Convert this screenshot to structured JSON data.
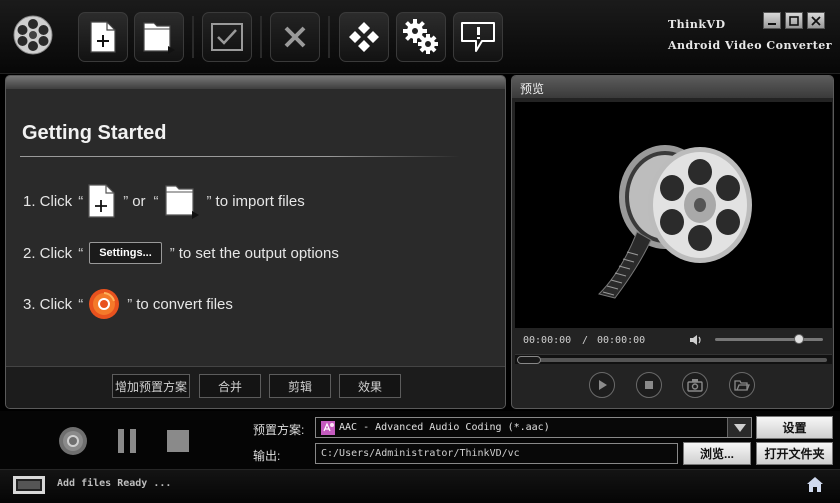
{
  "app": {
    "brand_line1": "ThinkVD",
    "brand_line2": "Android Video Converter"
  },
  "toolbar": {
    "icons": [
      "film-reel-icon",
      "add-file-icon",
      "add-folder-icon",
      "check-icon",
      "close-icon",
      "diamond-grid-icon",
      "gears-icon",
      "chat-bubble-icon"
    ]
  },
  "guide": {
    "title": "Getting Started",
    "step1": {
      "prefix": "1. Click",
      "or": "or",
      "suffix": "to import files"
    },
    "step2": {
      "prefix": "2. Click",
      "button": "Settings...",
      "suffix": "to set the output options"
    },
    "step3": {
      "prefix": "3. Click",
      "suffix": "to convert files"
    },
    "quote_open": "“",
    "quote_close": "”",
    "buttons": {
      "add_preset": "增加预置方案",
      "merge": "合并",
      "clip": "剪辑",
      "effects": "效果"
    }
  },
  "preview": {
    "title": "预览",
    "current_time": "00:00:00",
    "separator": "/",
    "total_time": "00:00:00",
    "volume": 0.78,
    "seek": 0.0
  },
  "output": {
    "preset_label": "预置方案:",
    "preset_value": "AAC - Advanced Audio Coding (*.aac)",
    "settings_button": "设置",
    "output_label": "输出:",
    "output_path": "C:/Users/Administrator/ThinkVD/vc",
    "browse_button": "浏览...",
    "open_folder_button": "打开文件夹"
  },
  "status": {
    "text": "Add files Ready ..."
  },
  "colors": {
    "accent_orange": "#e8521e",
    "panel_bg": "#2a2a2a",
    "background": "#000000"
  }
}
